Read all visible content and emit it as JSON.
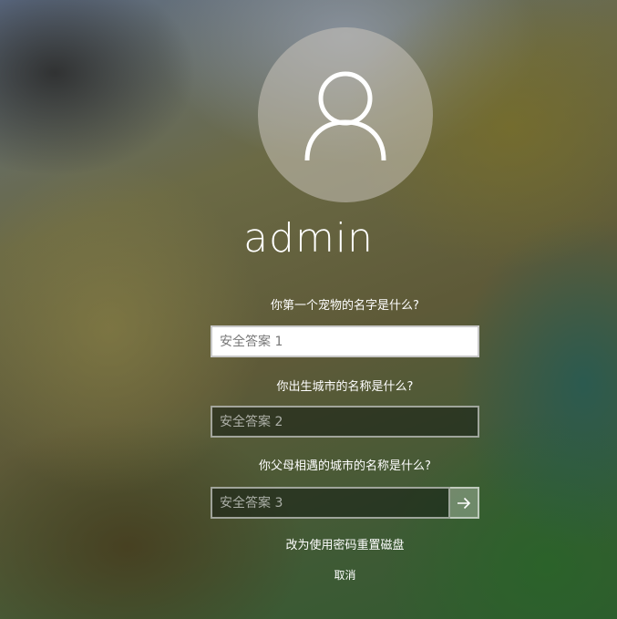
{
  "user": {
    "name": "admin",
    "avatar_icon": "user-icon"
  },
  "security_questions": [
    {
      "question": "你第一个宠物的名字是什么?",
      "placeholder": "安全答案 1"
    },
    {
      "question": "你出生城市的名称是什么?",
      "placeholder": "安全答案 2"
    },
    {
      "question": "你父母相遇的城市的名称是什么?",
      "placeholder": "安全答案 3"
    }
  ],
  "submit": {
    "icon": "arrow-right-icon"
  },
  "links": {
    "use_reset_disk": "改为使用密码重置磁盘",
    "cancel": "取消"
  }
}
